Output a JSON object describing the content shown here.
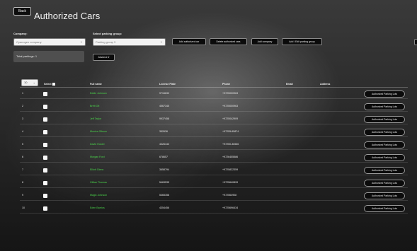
{
  "header": {
    "back_label": "Back",
    "title": "Authorized Cars"
  },
  "filters": {
    "company_label": "Company:",
    "company_value": "Cyanogen company",
    "group_label": "Select parking group:",
    "group_value": "Parking group 3"
  },
  "toolbar": {
    "add_authorized_car": "Add authorized car",
    "delete_authorized_cars": "Delete authorized cars",
    "add_company": "Add company",
    "add_edit_parking_group": "Add / Edit parking group"
  },
  "summary": {
    "total_parkings_label": "Total parkings:",
    "total_parkings_value": "1"
  },
  "advance": {
    "label": "Advance"
  },
  "table": {
    "page_size": "10",
    "columns": [
      "",
      "Select",
      "Full name",
      "License Plate",
      "Phone",
      "Email",
      "Address"
    ],
    "row_button_label": "Authorized Parking Lots",
    "rows": [
      {
        "num": "1",
        "name": "Eddie Johnson",
        "plate": "9734630",
        "phone": "+9725000963"
      },
      {
        "num": "2",
        "name": "Brett Ott",
        "plate": "4567345",
        "phone": "+9725000963"
      },
      {
        "num": "3",
        "name": "Jeff Taylor",
        "plate": "9937458",
        "phone": "+9725042909"
      },
      {
        "num": "4",
        "name": "Monica Gibson",
        "plate": "352636",
        "phone": "+97255-65874"
      },
      {
        "num": "5",
        "name": "David Hoster",
        "plate": "4326443",
        "phone": "+97250-36566"
      },
      {
        "num": "6",
        "name": "Morgan Ford",
        "plate": "678657",
        "phone": "+9726455586"
      },
      {
        "num": "7",
        "name": "Elliott Glenn",
        "plate": "3658794",
        "phone": "+9725822359"
      },
      {
        "num": "8",
        "name": "Gillian Thomas",
        "plate": "5463535",
        "phone": "+9725640899"
      },
      {
        "num": "9",
        "name": "Magic Johnson",
        "plate": "5465358",
        "phone": "+972564908"
      },
      {
        "num": "10",
        "name": "Eden Barrios",
        "plate": "4354456",
        "phone": "+9725696434"
      }
    ]
  }
}
